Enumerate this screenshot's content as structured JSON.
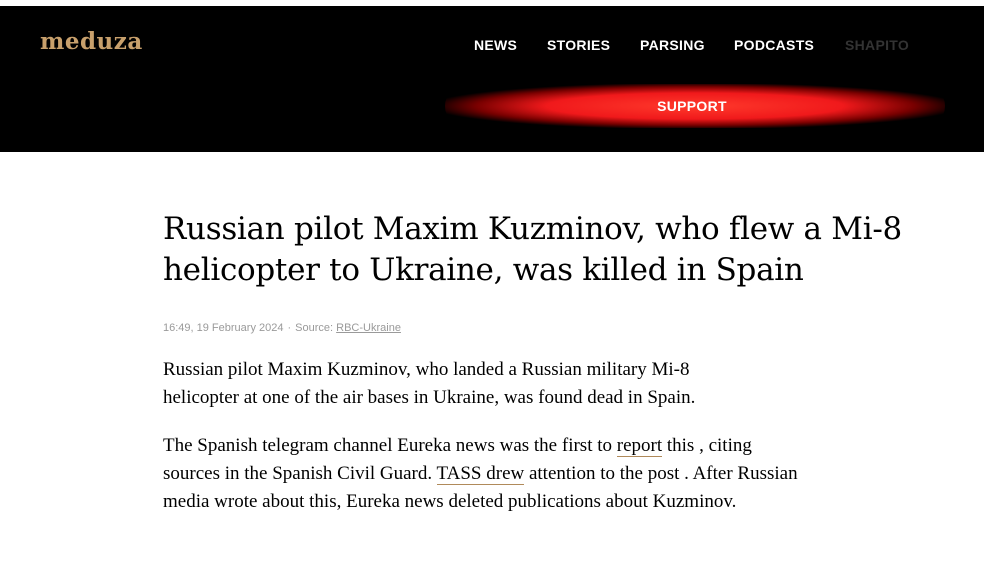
{
  "header": {
    "logo": "meduza",
    "nav": [
      "NEWS",
      "STORIES",
      "PARSING",
      "PODCASTS",
      "SHAPITO"
    ],
    "support_label": "SUPPORT",
    "colors": {
      "background": "#000000",
      "logo": "#c8a06c",
      "support": "#f0191b"
    }
  },
  "article": {
    "title": "Russian pilot Maxim Kuzminov, who flew a Mi-8 helicopter to Ukraine, was killed in Spain",
    "meta": {
      "time": "16:49, 19 February 2024",
      "separator": "·",
      "source_prefix": "Source:",
      "source_name": "RBC-Ukraine"
    },
    "paragraph1": "Russian pilot Maxim Kuzminov, who landed a Russian military Mi-8 helicopter at one of the air bases in Ukraine, was found dead in Spain.",
    "paragraph2": {
      "part1": "The Spanish telegram channel Eureka news was the first to ",
      "link1": "report",
      "part2": " this , citing sources in the Spanish Civil Guard. ",
      "link2": "TASS drew",
      "part3": " attention to the post . After Russian media wrote about this, Eureka news deleted publications about Kuzminov."
    }
  }
}
